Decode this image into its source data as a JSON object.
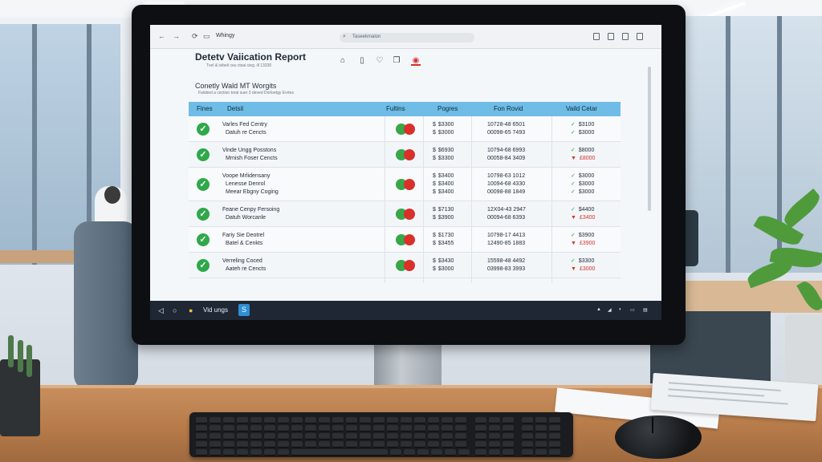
{
  "browser": {
    "tab_label": "Whingy",
    "address_text": "Taseekmalon"
  },
  "page": {
    "title": "Detetv Vaiication Report",
    "subtitle": "Tvel & ivibeli ceu ctsal cieg. ill 13330",
    "section_title": "Conetly Wald MT Worgits",
    "section_subtitle": "Falsbed a cection toral suer 3 deved Dorloetgy Evrtes"
  },
  "table": {
    "headers": [
      "Fines",
      "Detsil",
      "Fultins",
      "Pogres",
      "Fon Rovid",
      "Vaild Cetar"
    ],
    "rows": [
      {
        "status": "valid",
        "detail": [
          "Varles Fed Centry",
          "Datuh re Cencts"
        ],
        "pogres": [
          [
            "$",
            "$3300"
          ],
          [
            "$",
            "$3000"
          ]
        ],
        "fon_rovid": [
          "10728-48 6501",
          "00098-65 7493"
        ],
        "vaild_cetar": [
          [
            "up",
            "$3100"
          ],
          [
            "up",
            "$3000"
          ]
        ]
      },
      {
        "status": "valid",
        "detail": [
          "Vinde Ungg Posstons",
          "Mrnish Foser Cencts"
        ],
        "pogres": [
          [
            "$",
            "$6930"
          ],
          [
            "$",
            "$3300"
          ]
        ],
        "fon_rovid": [
          "10794-68 6993",
          "00058-84 3409"
        ],
        "vaild_cetar": [
          [
            "up",
            "$8000"
          ],
          [
            "down",
            "£8000"
          ]
        ]
      },
      {
        "status": "valid",
        "detail": [
          "Voope Mrlidensany",
          "Lenesse Denrol",
          "Meear Ebgny Coging"
        ],
        "pogres": [
          [
            "$",
            "$3400"
          ],
          [
            "$",
            "$3400"
          ],
          [
            "$",
            "$3400"
          ]
        ],
        "fon_rovid": [
          "10798-63 1012",
          "10094-68 4330",
          "00098-88 1849"
        ],
        "vaild_cetar": [
          [
            "up",
            "$3000"
          ],
          [
            "up",
            "$3000"
          ],
          [
            "up",
            "$3000"
          ]
        ]
      },
      {
        "status": "valid",
        "detail": [
          "Feane Cenpy Fersoing",
          "Datuh Worcanle"
        ],
        "pogres": [
          [
            "$",
            "$7130"
          ],
          [
            "$",
            "$3900"
          ]
        ],
        "fon_rovid": [
          "12X04-43 2947",
          "00094-68 6393"
        ],
        "vaild_cetar": [
          [
            "up",
            "$4400"
          ],
          [
            "down",
            "£3400"
          ]
        ]
      },
      {
        "status": "valid",
        "detail": [
          "Fariy Sie Deotrel",
          "Batel & Cenkts"
        ],
        "pogres": [
          [
            "$",
            "$1730"
          ],
          [
            "$",
            "$3455"
          ]
        ],
        "fon_rovid": [
          "10798-17 4413",
          "12490-85 1883"
        ],
        "vaild_cetar": [
          [
            "up",
            "$3900"
          ],
          [
            "down",
            "£3900"
          ]
        ]
      },
      {
        "status": "valid",
        "detail": [
          "Verreling Coced",
          "Aateh re Cencts"
        ],
        "pogres": [
          [
            "$",
            "$3430"
          ],
          [
            "$",
            "$3000"
          ]
        ],
        "fon_rovid": [
          "15598-48 4492",
          "03998-83 3993"
        ],
        "vaild_cetar": [
          [
            "up",
            "$3300"
          ],
          [
            "down",
            "£3000"
          ]
        ]
      }
    ]
  },
  "taskbar": {
    "app_label": "Vid ungs"
  },
  "icons": {
    "nav_back": "back-arrow-icon",
    "nav_forward": "forward-arrow-icon",
    "refresh": "refresh-icon",
    "home": "home-icon",
    "document": "document-icon",
    "heart": "heart-icon",
    "pages": "pages-icon",
    "alert": "alert-icon"
  },
  "colors": {
    "header_bg": "#6fbce6",
    "valid_green": "#2ea84a",
    "error_red": "#d9302b",
    "taskbar": "#1e2733"
  }
}
